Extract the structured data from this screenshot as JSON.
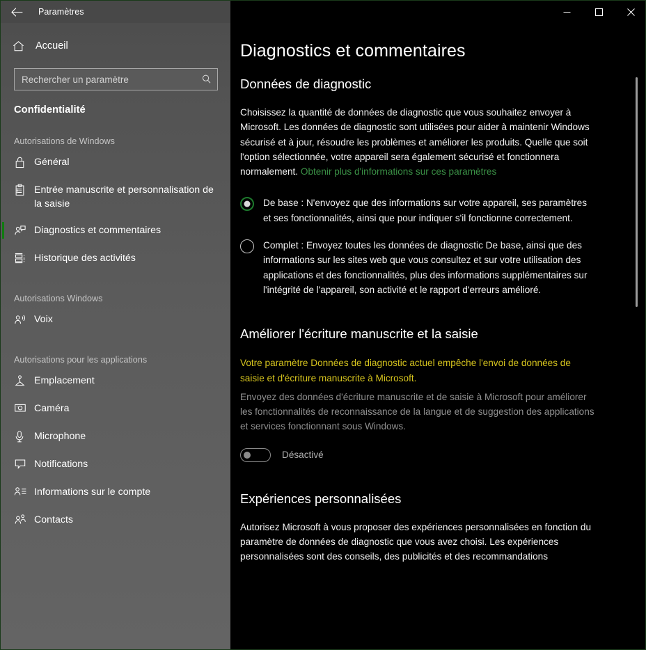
{
  "window": {
    "title": "Paramètres",
    "back_icon": "arrow-left-icon",
    "controls": {
      "minimize": "minimize-icon",
      "maximize": "maximize-icon",
      "close": "close-icon"
    }
  },
  "sidebar": {
    "home": {
      "label": "Accueil",
      "icon": "home-icon"
    },
    "search": {
      "placeholder": "Rechercher un paramètre",
      "value": "",
      "icon": "search-icon"
    },
    "category": "Confidentialité",
    "groups": [
      {
        "heading": "Autorisations de Windows",
        "items": [
          {
            "label": "Général",
            "icon": "lock-icon",
            "selected": false
          },
          {
            "label": "Entrée manuscrite et personnalisation de la saisie",
            "icon": "clipboard-icon",
            "selected": false
          },
          {
            "label": "Diagnostics et commentaires",
            "icon": "person-feedback-icon",
            "selected": true
          },
          {
            "label": "Historique des activités",
            "icon": "timeline-icon",
            "selected": false
          }
        ]
      },
      {
        "heading": "Autorisations Windows",
        "items": [
          {
            "label": "Voix",
            "icon": "person-speech-icon",
            "selected": false
          }
        ]
      },
      {
        "heading": "Autorisations pour les applications",
        "items": [
          {
            "label": "Emplacement",
            "icon": "location-icon",
            "selected": false
          },
          {
            "label": "Caméra",
            "icon": "camera-icon",
            "selected": false
          },
          {
            "label": "Microphone",
            "icon": "microphone-icon",
            "selected": false
          },
          {
            "label": "Notifications",
            "icon": "notification-icon",
            "selected": false
          },
          {
            "label": "Informations sur le compte",
            "icon": "account-info-icon",
            "selected": false
          },
          {
            "label": "Contacts",
            "icon": "contacts-icon",
            "selected": false
          }
        ]
      }
    ]
  },
  "main": {
    "page_title": "Diagnostics et commentaires",
    "sections": {
      "diagnostic_data": {
        "heading": "Données de diagnostic",
        "description": "Choisissez la quantité de données de diagnostic que vous souhaitez envoyer à Microsoft. Les données de diagnostic sont utilisées pour aider à maintenir Windows sécurisé et à jour, résoudre les problèmes et améliorer les produits. Quelle que soit l'option sélectionnée, votre appareil sera également sécurisé et fonctionnera normalement. ",
        "link_text": "Obtenir plus d'informations sur ces paramètres",
        "options": [
          {
            "label": "De base : N'envoyez que des informations sur votre appareil, ses paramètres et ses fonctionnalités, ainsi que pour indiquer s'il fonctionne correctement.",
            "selected": true
          },
          {
            "label": "Complet : Envoyez toutes les données de diagnostic De base, ainsi que des informations sur les sites web que vous consultez et sur votre utilisation des applications et des fonctionnalités, plus des informations supplémentaires sur l'intégrité de l'appareil, son activité et le rapport d'erreurs amélioré.",
            "selected": false
          }
        ]
      },
      "handwriting": {
        "heading": "Améliorer l'écriture manuscrite et la saisie",
        "warning": "Votre paramètre Données de diagnostic actuel empêche l'envoi de données de saisie et d'écriture manuscrite à Microsoft.",
        "description": "Envoyez des données d'écriture manuscrite et de saisie à Microsoft pour améliorer les fonctionnalités de reconnaissance de la langue et de suggestion des applications et services fonctionnant sous Windows.",
        "toggle_label": "Désactivé",
        "toggle_state": "off"
      },
      "personalized": {
        "heading": "Expériences personnalisées",
        "description": "Autorisez Microsoft à vous proposer des expériences personnalisées en fonction du paramètre de données de diagnostic que vous avez choisi. Les expériences personnalisées sont des conseils, des publicités et des recommandations"
      }
    }
  },
  "colors": {
    "accent_green": "#107c10",
    "link_green": "#3a8f45",
    "warning_yellow": "#d7c51e",
    "sidebar_gray": "#5a5a5a",
    "content_black": "#000000"
  }
}
